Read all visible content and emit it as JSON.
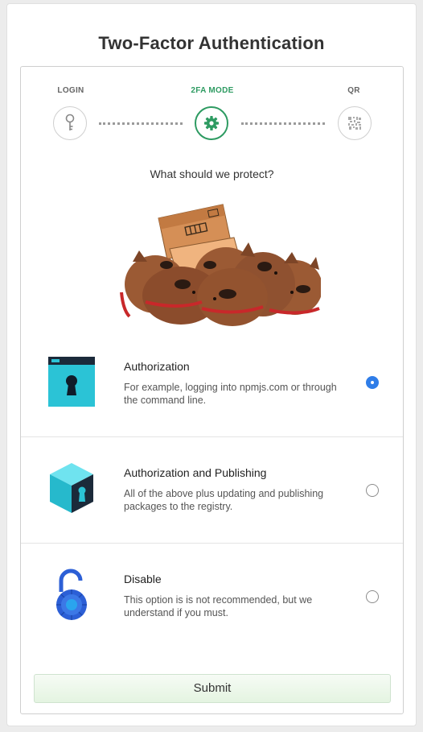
{
  "page": {
    "title": "Two-Factor Authentication"
  },
  "steps": [
    {
      "label": "LOGIN",
      "icon": "key-icon",
      "active": false
    },
    {
      "label": "2FA MODE",
      "icon": "gear-icon",
      "active": true
    },
    {
      "label": "QR",
      "icon": "qr-code-icon",
      "active": false
    }
  ],
  "question": "What should we protect?",
  "options": [
    {
      "title": "Authorization",
      "description": "For example, logging into npmjs.com or through the command line.",
      "icon": "keyhole-window-icon",
      "selected": true
    },
    {
      "title": "Authorization and Publishing",
      "description": "All of the above plus updating and publishing packages to the registry.",
      "icon": "keyhole-cube-icon",
      "selected": false
    },
    {
      "title": "Disable",
      "description": "This option is is not recommended, but we understand if you must.",
      "icon": "open-padlock-icon",
      "selected": false
    }
  ],
  "submit_label": "Submit",
  "colors": {
    "accent_green": "#2e9b62",
    "radio_blue": "#2f7de8",
    "teal": "#2bc3d6",
    "padlock_blue": "#2c5fd6"
  }
}
